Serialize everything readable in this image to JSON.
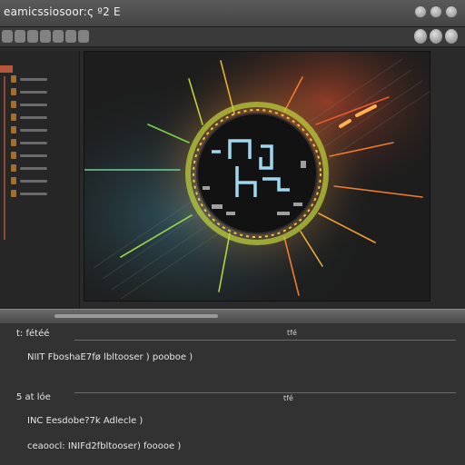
{
  "window": {
    "title": "eamicssiosoor:ς º2 E"
  },
  "console": {
    "line1_label": "t: fétéé",
    "line1_end": "tfé",
    "line2": "NIIT FboshaE7fø lbltooser ) pooboe )",
    "line3_label": "5 at lóe",
    "line3_end": "tfé",
    "line4": "INC Eesdobe?7k Adlecle )",
    "line5": "ceaoocl: INIFd2fbltooser) fooooe )"
  },
  "icons": [
    "close-icon",
    "minimize-icon",
    "maximize-icon",
    "settings-icon",
    "refresh-icon"
  ],
  "colors": {
    "accent": "#f07b2c",
    "glow_green": "#a5d64a",
    "glow_cyan": "#54c8e8",
    "glow_red": "#e8532c"
  }
}
